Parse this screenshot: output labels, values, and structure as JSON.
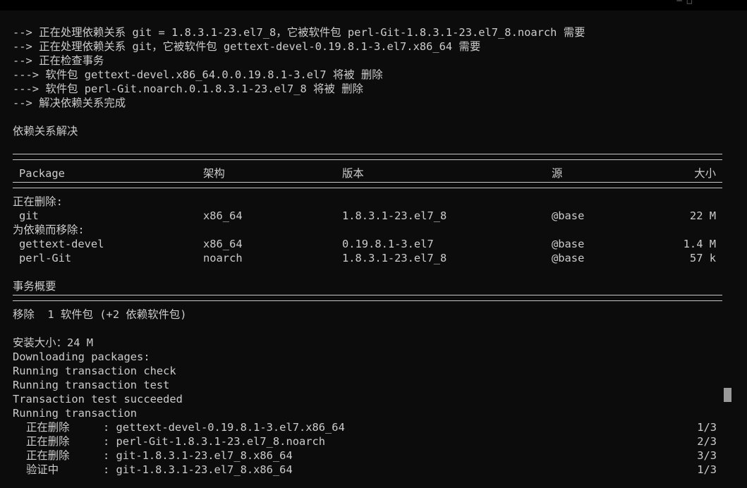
{
  "window": {
    "controls": "─ □"
  },
  "log": [
    "--> 正在处理依赖关系 git = 1.8.3.1-23.el7_8，它被软件包 perl-Git-1.8.3.1-23.el7_8.noarch 需要",
    "--> 正在处理依赖关系 git，它被软件包 gettext-devel-0.19.8.1-3.el7.x86_64 需要",
    "--> 正在检查事务",
    "---> 软件包 gettext-devel.x86_64.0.0.19.8.1-3.el7 将被 删除",
    "---> 软件包 perl-Git.noarch.0.1.8.3.1-23.el7_8 将被 删除",
    "--> 解决依赖关系完成"
  ],
  "resolved": "依赖关系解决",
  "table": {
    "headers": {
      "package": "Package",
      "arch": "架构",
      "version": "版本",
      "repo": "源",
      "size": "大小"
    },
    "removing_label": "正在删除:",
    "dep_label": "为依赖而移除:",
    "rows": [
      {
        "package": "git",
        "arch": "x86_64",
        "version": "1.8.3.1-23.el7_8",
        "repo": "@base",
        "size": "22 M"
      },
      {
        "package": "gettext-devel",
        "arch": "x86_64",
        "version": "0.19.8.1-3.el7",
        "repo": "@base",
        "size": "1.4 M"
      },
      {
        "package": "perl-Git",
        "arch": "noarch",
        "version": "1.8.3.1-23.el7_8",
        "repo": "@base",
        "size": "57 k"
      }
    ]
  },
  "summary": {
    "title": "事务概要",
    "remove": "移除  1 软件包 (+2 依赖软件包)",
    "install_size": "安装大小：24 M",
    "lines": [
      "Downloading packages:",
      "Running transaction check",
      "Running transaction test",
      "Transaction test succeeded",
      "Running transaction"
    ]
  },
  "progress": [
    {
      "action": "正在删除",
      "pkg": ": gettext-devel-0.19.8.1-3.el7.x86_64",
      "count": "1/3"
    },
    {
      "action": "正在删除",
      "pkg": ": perl-Git-1.8.3.1-23.el7_8.noarch",
      "count": "2/3"
    },
    {
      "action": "正在删除",
      "pkg": ": git-1.8.3.1-23.el7_8.x86_64",
      "count": "3/3"
    },
    {
      "action": "验证中",
      "pkg": ": git-1.8.3.1-23.el7_8.x86_64",
      "count": "1/3"
    }
  ]
}
